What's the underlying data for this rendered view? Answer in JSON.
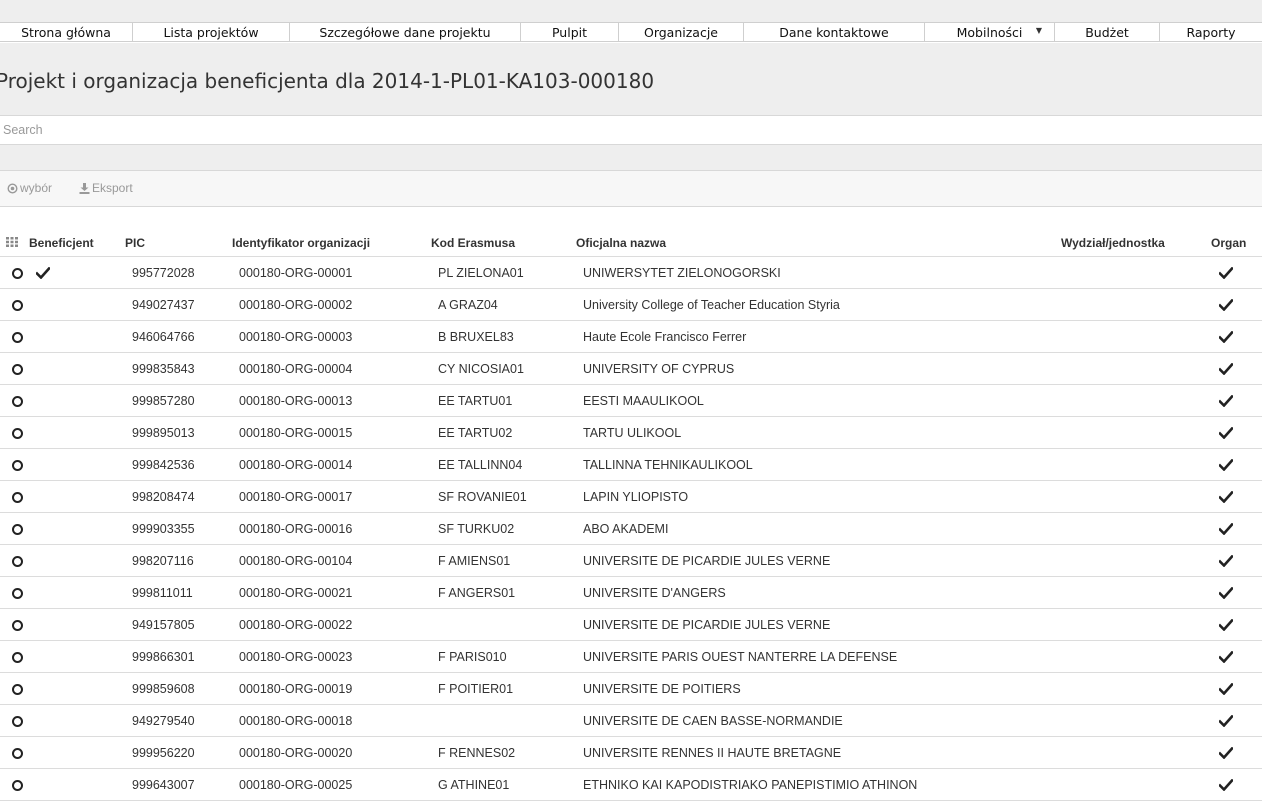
{
  "nav": {
    "items": [
      {
        "label": "Strona główna",
        "width": 133
      },
      {
        "label": "Lista projektów",
        "width": 157
      },
      {
        "label": "Szczegółowe dane projektu",
        "width": 231
      },
      {
        "label": "Pulpit",
        "width": 98
      },
      {
        "label": "Organizacje",
        "width": 125
      },
      {
        "label": "Dane kontaktowe",
        "width": 181
      },
      {
        "label": "Mobilności",
        "width": 130,
        "dropdown": true
      },
      {
        "label": "Budżet",
        "width": 105
      },
      {
        "label": "Raporty",
        "width": 102
      }
    ]
  },
  "page": {
    "title": "Projekt i organizacja beneficjenta dla 2014-1-PL01-KA103-000180"
  },
  "search": {
    "placeholder": "Search",
    "value": ""
  },
  "toolbar": {
    "select_label": "wybór",
    "export_label": "Eksport"
  },
  "table": {
    "columns": [
      "Beneficjent",
      "PIC",
      "Identyfikator organizacji",
      "Kod Erasmusa",
      "Oficjalna nazwa",
      "Wydział/jednostka",
      "Organ"
    ],
    "rows": [
      {
        "beneficiary": true,
        "pic": "995772028",
        "org_id": "000180-ORG-00001",
        "erasmus": "PL ZIELONA01",
        "name": "UNIWERSYTET ZIELONOGORSKI",
        "dept": "",
        "org": true
      },
      {
        "beneficiary": false,
        "pic": "949027437",
        "org_id": "000180-ORG-00002",
        "erasmus": "A GRAZ04",
        "name": "University College of Teacher Education Styria",
        "dept": "",
        "org": true
      },
      {
        "beneficiary": false,
        "pic": "946064766",
        "org_id": "000180-ORG-00003",
        "erasmus": "B BRUXEL83",
        "name": "Haute Ecole Francisco Ferrer",
        "dept": "",
        "org": true
      },
      {
        "beneficiary": false,
        "pic": "999835843",
        "org_id": "000180-ORG-00004",
        "erasmus": "CY NICOSIA01",
        "name": "UNIVERSITY OF CYPRUS",
        "dept": "",
        "org": true
      },
      {
        "beneficiary": false,
        "pic": "999857280",
        "org_id": "000180-ORG-00013",
        "erasmus": "EE TARTU01",
        "name": "EESTI MAAULIKOOL",
        "dept": "",
        "org": true
      },
      {
        "beneficiary": false,
        "pic": "999895013",
        "org_id": "000180-ORG-00015",
        "erasmus": "EE TARTU02",
        "name": "TARTU ULIKOOL",
        "dept": "",
        "org": true
      },
      {
        "beneficiary": false,
        "pic": "999842536",
        "org_id": "000180-ORG-00014",
        "erasmus": "EE TALLINN04",
        "name": "TALLINNA TEHNIKAULIKOOL",
        "dept": "",
        "org": true
      },
      {
        "beneficiary": false,
        "pic": "998208474",
        "org_id": "000180-ORG-00017",
        "erasmus": "SF ROVANIE01",
        "name": "LAPIN YLIOPISTO",
        "dept": "",
        "org": true
      },
      {
        "beneficiary": false,
        "pic": "999903355",
        "org_id": "000180-ORG-00016",
        "erasmus": "SF TURKU02",
        "name": "ABO AKADEMI",
        "dept": "",
        "org": true
      },
      {
        "beneficiary": false,
        "pic": "998207116",
        "org_id": "000180-ORG-00104",
        "erasmus": "F AMIENS01",
        "name": "UNIVERSITE DE PICARDIE JULES VERNE",
        "dept": "",
        "org": true
      },
      {
        "beneficiary": false,
        "pic": "999811011",
        "org_id": "000180-ORG-00021",
        "erasmus": "F ANGERS01",
        "name": "UNIVERSITE D'ANGERS",
        "dept": "",
        "org": true
      },
      {
        "beneficiary": false,
        "pic": "949157805",
        "org_id": "000180-ORG-00022",
        "erasmus": "",
        "name": "UNIVERSITE DE PICARDIE JULES VERNE",
        "dept": "",
        "org": true
      },
      {
        "beneficiary": false,
        "pic": "999866301",
        "org_id": "000180-ORG-00023",
        "erasmus": "F PARIS010",
        "name": "UNIVERSITE PARIS OUEST NANTERRE LA DEFENSE",
        "dept": "",
        "org": true
      },
      {
        "beneficiary": false,
        "pic": "999859608",
        "org_id": "000180-ORG-00019",
        "erasmus": "F POITIER01",
        "name": "UNIVERSITE DE POITIERS",
        "dept": "",
        "org": true
      },
      {
        "beneficiary": false,
        "pic": "949279540",
        "org_id": "000180-ORG-00018",
        "erasmus": "",
        "name": "UNIVERSITE DE CAEN BASSE-NORMANDIE",
        "dept": "",
        "org": true
      },
      {
        "beneficiary": false,
        "pic": "999956220",
        "org_id": "000180-ORG-00020",
        "erasmus": "F RENNES02",
        "name": "UNIVERSITE RENNES II HAUTE BRETAGNE",
        "dept": "",
        "org": true
      },
      {
        "beneficiary": false,
        "pic": "999643007",
        "org_id": "000180-ORG-00025",
        "erasmus": "G ATHINE01",
        "name": "ETHNIKO KAI KAPODISTRIAKO PANEPISTIMIO ATHINON",
        "dept": "",
        "org": true
      }
    ]
  },
  "icons": {
    "radio": "radio-button-icon",
    "check": "checkmark-icon",
    "grid": "grid-icon",
    "select": "circle-dot-icon",
    "export": "download-icon",
    "dropdown": "caret-down-icon"
  }
}
